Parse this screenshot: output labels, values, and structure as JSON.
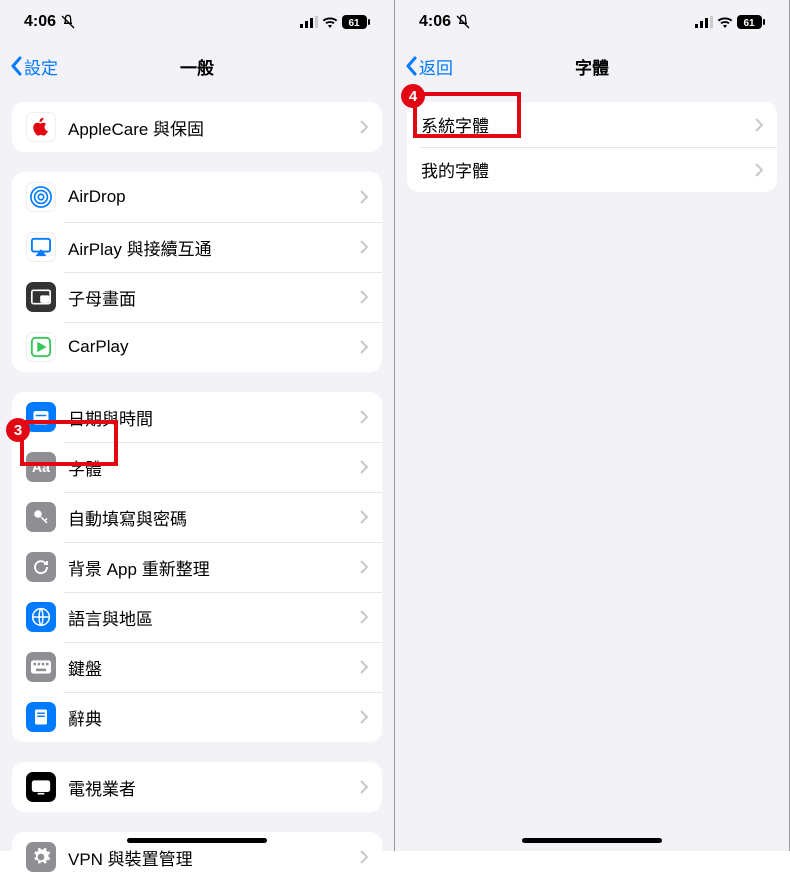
{
  "status": {
    "time": "4:06",
    "battery": "61"
  },
  "left": {
    "back_label": "設定",
    "title": "一般",
    "group1": [
      {
        "label": "AppleCare 與保固",
        "icon": "apple",
        "bg": "#ffffff",
        "fg": "#e30613"
      }
    ],
    "group2": [
      {
        "label": "AirDrop",
        "icon": "airdrop",
        "bg": "#ffffff",
        "fg": "#007aff"
      },
      {
        "label": "AirPlay 與接續互通",
        "icon": "airplay",
        "bg": "#ffffff",
        "fg": "#007aff"
      },
      {
        "label": "子母畫面",
        "icon": "pip",
        "bg": "#333333",
        "fg": "#ffffff"
      },
      {
        "label": "CarPlay",
        "icon": "carplay",
        "bg": "#ffffff",
        "fg": "#34c759"
      }
    ],
    "group3": [
      {
        "label": "日期與時間",
        "icon": "datetime",
        "bg": "#007aff",
        "fg": "#ffffff"
      },
      {
        "label": "字體",
        "icon": "fonts",
        "bg": "#8e8e93",
        "fg": "#ffffff"
      },
      {
        "label": "自動填寫與密碼",
        "icon": "keys",
        "bg": "#8e8e93",
        "fg": "#ffffff"
      },
      {
        "label": "背景 App 重新整理",
        "icon": "refresh",
        "bg": "#8e8e93",
        "fg": "#ffffff"
      },
      {
        "label": "語言與地區",
        "icon": "globe",
        "bg": "#007aff",
        "fg": "#ffffff"
      },
      {
        "label": "鍵盤",
        "icon": "keyboard",
        "bg": "#8e8e93",
        "fg": "#ffffff"
      },
      {
        "label": "辭典",
        "icon": "dictionary",
        "bg": "#007aff",
        "fg": "#ffffff"
      }
    ],
    "group4": [
      {
        "label": "電視業者",
        "icon": "tv",
        "bg": "#000000",
        "fg": "#ffffff"
      }
    ],
    "group5": [
      {
        "label": "VPN 與裝置管理",
        "icon": "vpn",
        "bg": "#8e8e93",
        "fg": "#ffffff"
      }
    ]
  },
  "right": {
    "back_label": "返回",
    "title": "字體",
    "group1": [
      {
        "label": "系統字體"
      },
      {
        "label": "我的字體"
      }
    ]
  },
  "annotations": {
    "badge3": "3",
    "badge4": "4"
  }
}
